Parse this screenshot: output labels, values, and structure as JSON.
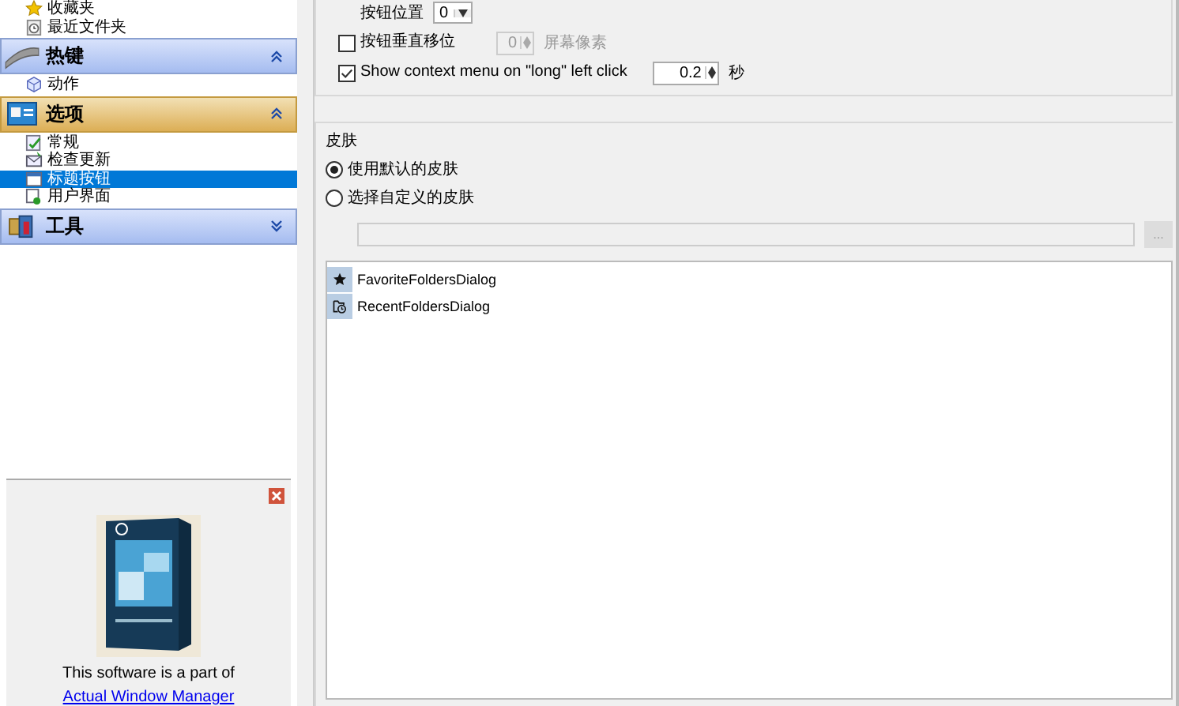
{
  "sidebar": {
    "top_items": [
      {
        "label": "收藏夹",
        "kind": "star",
        "selected": false
      },
      {
        "label": "最近文件夹",
        "kind": "recent",
        "selected": false
      }
    ],
    "sections": [
      {
        "title": "热键",
        "kind": "hotkey",
        "selected": false,
        "expanded": true,
        "items": [
          {
            "label": "动作",
            "kind": "action",
            "selected": false
          }
        ]
      },
      {
        "title": "选项",
        "kind": "options",
        "selected": true,
        "expanded": true,
        "items": [
          {
            "label": "常规",
            "kind": "general",
            "selected": false
          },
          {
            "label": "检查更新",
            "kind": "update",
            "selected": false
          },
          {
            "label": "标题按钮",
            "kind": "titlebutton",
            "selected": true
          },
          {
            "label": "用户界面",
            "kind": "ui",
            "selected": false
          }
        ]
      },
      {
        "title": "工具",
        "kind": "tools",
        "selected": false,
        "expanded": false
      }
    ]
  },
  "ad": {
    "text": "This software is a part of",
    "link": "Actual Window Manager"
  },
  "button_settings": {
    "position": {
      "label": "按钮位置",
      "value": "0"
    },
    "vertical_shift": {
      "label": "按钮垂直移位",
      "checked": false,
      "value": "0",
      "unit": "屏幕像素"
    },
    "context_menu": {
      "label": "Show context menu on \"long\" left click",
      "checked": true,
      "value": "0.2",
      "unit": "秒"
    }
  },
  "skin": {
    "title": "皮肤",
    "options": [
      {
        "label": "使用默认的皮肤",
        "selected": true
      },
      {
        "label": "选择自定义的皮肤",
        "selected": false
      }
    ],
    "browse_button": "...",
    "list": [
      {
        "label": "FavoriteFoldersDialog",
        "kind": "star"
      },
      {
        "label": "RecentFoldersDialog",
        "kind": "recent"
      }
    ]
  }
}
